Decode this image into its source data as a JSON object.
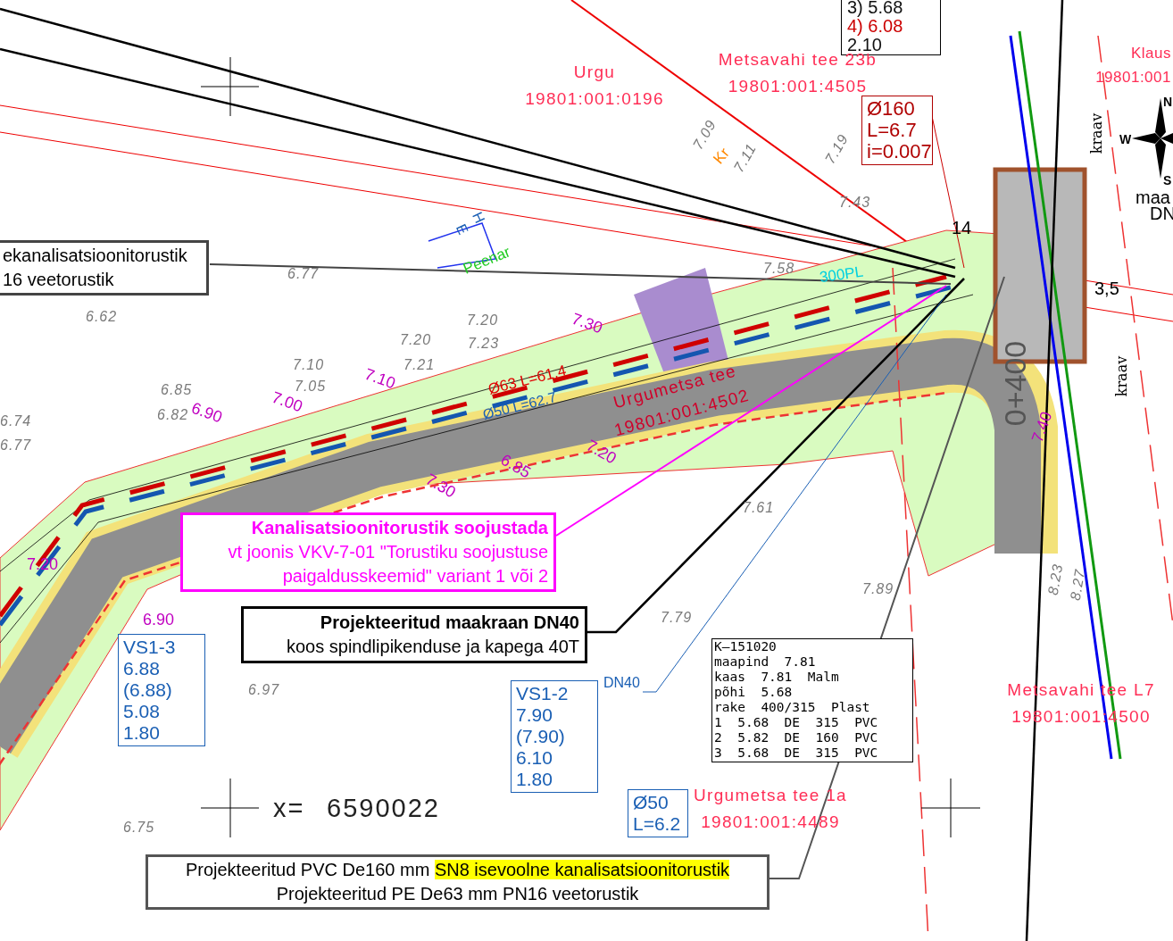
{
  "notes": [
    {
      "kind": "plain",
      "lines": [
        "ekanalisatsioonitorustik",
        "16 veetorustik"
      ]
    },
    {
      "kind": "insulation",
      "lines": [
        "Kanalisatsioonitorustik soojustada",
        "vt joonis VKV-7-01 \"Torustiku soojustuse",
        "paigaldusskeemid\" variant 1 või 2"
      ]
    },
    {
      "kind": "hydrant",
      "lines": [
        "Projekteeritud maakraan DN40",
        "koos spindlipikenduse ja kapega 40T"
      ]
    },
    {
      "kind": "legend",
      "lines": [
        {
          "text": "Projekteeritud PVC De160 mm",
          "highlight": "SN8 isevoolne kanalisatsioonitorustik"
        },
        {
          "text": "Projekteeritud PE De63 mm PN16 veetorustik"
        }
      ]
    }
  ],
  "tags": [
    {
      "kind": "level",
      "lines": [
        {
          "text": "3) 5.68",
          "color": "#111111"
        },
        {
          "text": "4) 6.08",
          "color": "#cc0000"
        },
        {
          "text": "2.10",
          "color": "#111111"
        }
      ]
    },
    {
      "kind": "sewer",
      "lines": [
        {
          "text": "Ø160"
        },
        {
          "text": "L=6.7"
        },
        {
          "text": "i=0.007"
        }
      ]
    },
    {
      "kind": "water",
      "lines": [
        {
          "text": "VS1-3"
        },
        {
          "text": "6.88"
        },
        {
          "text": "(6.88)"
        },
        {
          "text": "5.08"
        },
        {
          "text": "1.80"
        }
      ]
    },
    {
      "kind": "water",
      "lines": [
        {
          "text": "VS1-2"
        },
        {
          "text": "7.90"
        },
        {
          "text": "(7.90)"
        },
        {
          "text": "6.10"
        },
        {
          "text": "1.80"
        }
      ]
    },
    {
      "kind": "water",
      "lines": [
        {
          "text": "Ø50"
        },
        {
          "text": "L=6.2"
        }
      ]
    }
  ],
  "manhole_card": [
    "K—151020",
    "maapind  7.81",
    "kaas  7.81  Malm",
    "põhi  5.68",
    "rake  400/315  Plast",
    "1  5.68  DE  315  PVC",
    "2  5.82  DE  160  PVC",
    "3  5.68  DE  315  PVC"
  ],
  "parcels": [
    {
      "name": "Urgu",
      "number": "19801:001:0196"
    },
    {
      "name": "Metsavahi  tee  23b",
      "number": "19801:001:4505"
    },
    {
      "name": "Klaus",
      "number": "19801:001"
    },
    {
      "name": "Urgumetsa  tee",
      "number": "19801:001:4502"
    },
    {
      "name": "Urgumetsa  tee  1a",
      "number": "19801:001:4489"
    },
    {
      "name": "Metsavahi  tee  L7",
      "number": "19801:001:4500"
    }
  ],
  "elevations": [
    "6.77",
    "6.62",
    "6.85",
    "6.82",
    "6.74",
    "6.77",
    "7.10",
    "7.05",
    "7.20",
    "7.21",
    "7.20",
    "7.23",
    "7.09",
    "7.11",
    "7.19",
    "7.58",
    "7.43",
    "7.61",
    "7.79",
    "7.89",
    "6.97",
    "6.75",
    "8.23",
    "8.27"
  ],
  "contours": [
    "7.30",
    "7.00",
    "7.10",
    "6.90",
    "7.20",
    "6.90",
    "6.85",
    "7.30",
    "7.20",
    "7.40"
  ],
  "labels": [
    {
      "kind": "sewer",
      "text": "Ø63 L=61.4"
    },
    {
      "kind": "water",
      "text": "Ø50 L=62.7"
    },
    {
      "kind": "water",
      "text": "DN40"
    },
    {
      "kind": "cyan",
      "text": "300PL"
    },
    {
      "kind": "dim",
      "text": "14"
    },
    {
      "kind": "dim",
      "text": "3,5"
    },
    {
      "kind": "green",
      "text": "Peenar"
    },
    {
      "kind": "ditch",
      "text": "kraav"
    },
    {
      "kind": "ditch",
      "text": "kraav"
    },
    {
      "kind": "dim",
      "text": "maa"
    },
    {
      "kind": "dim",
      "text": "DN"
    },
    {
      "kind": "orange",
      "text": "Kr"
    },
    {
      "kind": "station",
      "text": "0+400"
    },
    {
      "kind": "water",
      "text": "H"
    },
    {
      "kind": "water",
      "text": "E"
    }
  ],
  "compass": [
    "N",
    "W",
    "S"
  ],
  "coordinate": {
    "label": "x=",
    "value": "6590022"
  }
}
